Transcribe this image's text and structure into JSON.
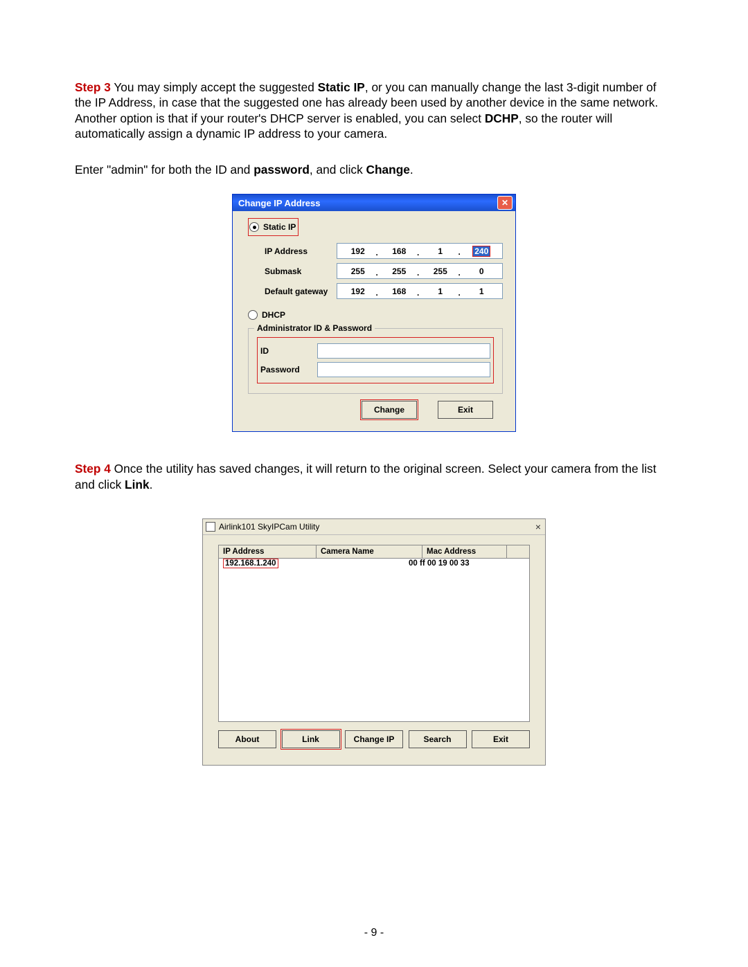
{
  "step3": {
    "label": "Step 3",
    "text_a": " You may simply accept the suggested ",
    "bold_a": "Static IP",
    "text_b": ", or you can manually change the last 3-digit number of the IP Address, in case that the suggested one has already been used by another device in the same network. Another option is that if your router's DHCP server is enabled, you can select ",
    "bold_b": "DCHP",
    "text_c": ", so the router will automatically assign a dynamic IP address to your camera."
  },
  "enter_line": {
    "a": "Enter \"admin\" for both the ID and ",
    "b": "password",
    "c": ", and click ",
    "d": "Change",
    "e": "."
  },
  "dlg1": {
    "title": "Change IP Address",
    "static_ip": "Static IP",
    "ip_label": "IP Address",
    "submask_label": "Submask",
    "gateway_label": "Default gateway",
    "dhcp": "DHCP",
    "ip": [
      "192",
      "168",
      "1",
      "240"
    ],
    "submask": [
      "255",
      "255",
      "255",
      "0"
    ],
    "gateway": [
      "192",
      "168",
      "1",
      "1"
    ],
    "group_title": "Administrator ID & Password",
    "id_label": "ID",
    "pw_label": "Password",
    "change_btn": "Change",
    "exit_btn": "Exit"
  },
  "step4": {
    "label": "Step 4",
    "text_a": " Once the utility has saved changes, it will return to the original screen.  Select your camera from the list and click ",
    "bold_a": "Link",
    "text_b": "."
  },
  "dlg2": {
    "title": "Airlink101 SkyIPCam Utility",
    "col_ip": "IP Address",
    "col_name": "Camera Name",
    "col_mac": "Mac Address",
    "row_ip": "192.168.1.240",
    "row_mac": "00 ff 00 19 00 33",
    "btn_about": "About",
    "btn_link": "Link",
    "btn_changeip": "Change IP",
    "btn_search": "Search",
    "btn_exit": "Exit"
  },
  "page_number": "- 9 -"
}
